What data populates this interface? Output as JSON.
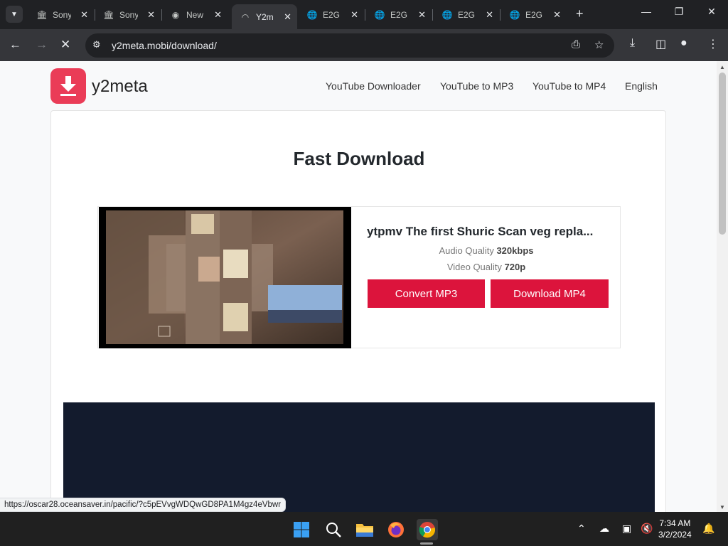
{
  "browser": {
    "tabs": [
      {
        "title": "Sony",
        "icon": "columns-icon"
      },
      {
        "title": "Sony",
        "icon": "columns-icon"
      },
      {
        "title": "New",
        "icon": "chrome-icon"
      },
      {
        "title": "Y2m",
        "icon": "loading-icon"
      },
      {
        "title": "E2G",
        "icon": "globe-icon"
      },
      {
        "title": "E2G",
        "icon": "globe-icon"
      },
      {
        "title": "E2G",
        "icon": "globe-icon"
      },
      {
        "title": "E2G",
        "icon": "globe-icon"
      }
    ],
    "active_tab_index": 3,
    "url": "y2meta.mobi/download/",
    "status_url": "https://oscar28.oceansaver.in/pacific/?c5pEVvgWDQwGD8PA1M4gz4eVbwr"
  },
  "site": {
    "brand": "y2meta",
    "brand_color": "#ea3c57",
    "nav": [
      "YouTube Downloader",
      "YouTube to MP3",
      "YouTube to MP4",
      "English"
    ]
  },
  "main": {
    "heading": "Fast Download",
    "video": {
      "title": "ytpmv The first Shuric Scan veg repla...",
      "audio_label": "Audio Quality",
      "audio_value": "320kbps",
      "video_label": "Video Quality",
      "video_value": "720p"
    },
    "buttons": {
      "convert": "Convert MP3",
      "download": "Download MP4"
    },
    "button_color": "#dc143c"
  },
  "taskbar": {
    "apps": [
      "windows-start-icon",
      "search-icon",
      "file-explorer-icon",
      "firefox-icon",
      "chrome-icon"
    ],
    "time": "7:34 AM",
    "date": "3/2/2024"
  }
}
